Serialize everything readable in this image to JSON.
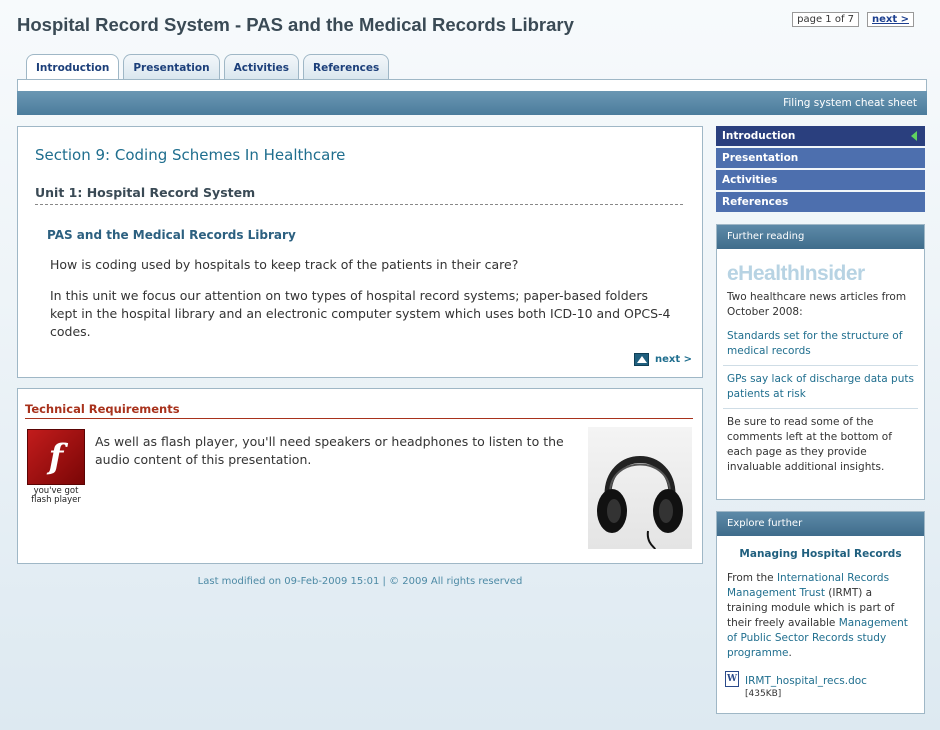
{
  "header": {
    "title": "Hospital Record System - PAS and the Medical Records Library",
    "page_indicator": "page 1 of 7",
    "next_label": "next >"
  },
  "tabs": [
    {
      "label": "Introduction",
      "active": true
    },
    {
      "label": "Presentation",
      "active": false
    },
    {
      "label": "Activities",
      "active": false
    },
    {
      "label": "References",
      "active": false
    }
  ],
  "bluebar": {
    "link": "Filing system cheat sheet"
  },
  "main": {
    "section_title": "Section 9: Coding Schemes In Healthcare",
    "unit_title": "Unit 1: Hospital Record System",
    "sub_title": "PAS and the Medical Records Library",
    "para1": "How is coding used by hospitals to keep track of the patients in their care?",
    "para2": "In this unit we focus our attention on two types of hospital record systems; paper-based folders kept in the hospital library and an electronic computer system which uses both ICD-10 and OPCS-4 codes.",
    "next_label": "next >"
  },
  "tech": {
    "title": "Technical Requirements",
    "flash_caption": "you've got flash player",
    "text": "As well as flash player, you'll need speakers or headphones to listen to the audio content of this presentation."
  },
  "footer": "Last modified on 09-Feb-2009 15:01 | © 2009 All rights reserved",
  "side_nav": [
    {
      "label": "Introduction",
      "active": true
    },
    {
      "label": "Presentation",
      "active": false
    },
    {
      "label": "Activities",
      "active": false
    },
    {
      "label": "References",
      "active": false
    }
  ],
  "further": {
    "head": "Further reading",
    "logo": "eHealthInsider",
    "intro": "Two healthcare news articles from October 2008:",
    "link1": "Standards set for the structure of medical records",
    "link2": "GPs say lack of discharge data puts patients at risk",
    "note": "Be sure to read some of the comments left at the bottom of each page as they provide invaluable additional insights."
  },
  "explore": {
    "head": "Explore further",
    "title": "Managing Hospital Records",
    "from": "From the",
    "org_link": "International Records Management Trust",
    "mid": "(IRMT) a training module which is part of their freely available",
    "prog_link": "Management of Public Sector Records study programme",
    "end": ".",
    "doc_name": "IRMT_hospital_recs.doc",
    "doc_size": "[435KB]"
  },
  "colors": {
    "accent": "#1f6e8e",
    "nav": "#4d6fae",
    "nav_active": "#2a3f7e",
    "warning": "#a8321c"
  }
}
